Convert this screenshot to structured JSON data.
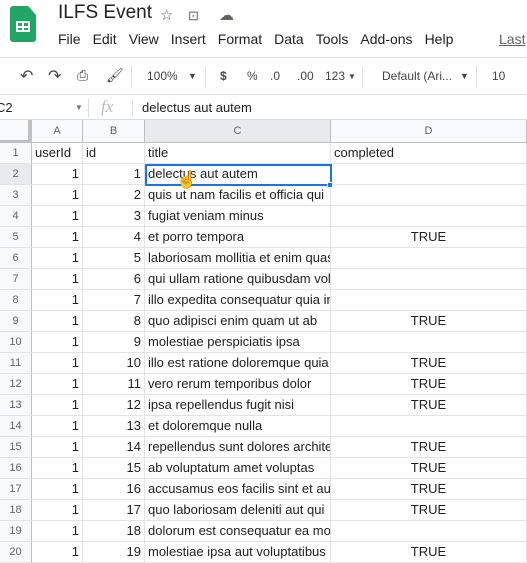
{
  "app": {
    "title": "ILFS Event",
    "last_edit": "Last",
    "icons": [
      "star-icon",
      "move-folder-icon",
      "cloud-saved-icon"
    ]
  },
  "menu": [
    "File",
    "Edit",
    "View",
    "Insert",
    "Format",
    "Data",
    "Tools",
    "Add-ons",
    "Help"
  ],
  "toolbar": {
    "zoom": "100%",
    "currency": "$",
    "percent": "%",
    "dec_decrease": ".0",
    "dec_increase": ".00",
    "format_more": "123",
    "font": "Default (Ari...",
    "font_size": "10"
  },
  "formula_bar": {
    "cell_ref": "C2",
    "fx": "fx",
    "value": "delectus aut autem"
  },
  "columns": [
    "A",
    "B",
    "C",
    "D"
  ],
  "header_row": [
    "userId",
    "id",
    "title",
    "completed"
  ],
  "rows": [
    [
      "1",
      "1",
      "delectus aut autem",
      ""
    ],
    [
      "1",
      "2",
      "quis ut nam facilis et officia qui",
      ""
    ],
    [
      "1",
      "3",
      "fugiat veniam minus",
      ""
    ],
    [
      "1",
      "4",
      "et porro tempora",
      "TRUE"
    ],
    [
      "1",
      "5",
      "laboriosam mollitia et enim quasi",
      ""
    ],
    [
      "1",
      "6",
      "qui ullam ratione quibusdam voluptatem",
      ""
    ],
    [
      "1",
      "7",
      "illo expedita consequatur quia in",
      ""
    ],
    [
      "1",
      "8",
      "quo adipisci enim quam ut ab",
      "TRUE"
    ],
    [
      "1",
      "9",
      "molestiae perspiciatis ipsa",
      ""
    ],
    [
      "1",
      "10",
      "illo est ratione doloremque quia",
      "TRUE"
    ],
    [
      "1",
      "11",
      "vero rerum temporibus dolor",
      "TRUE"
    ],
    [
      "1",
      "12",
      "ipsa repellendus fugit nisi",
      "TRUE"
    ],
    [
      "1",
      "13",
      "et doloremque nulla",
      ""
    ],
    [
      "1",
      "14",
      "repellendus sunt dolores architecto",
      "TRUE"
    ],
    [
      "1",
      "15",
      "ab voluptatum amet voluptas",
      "TRUE"
    ],
    [
      "1",
      "16",
      "accusamus eos facilis sint et aut",
      "TRUE"
    ],
    [
      "1",
      "17",
      "quo laboriosam deleniti aut qui",
      "TRUE"
    ],
    [
      "1",
      "18",
      "dolorum est consequatur ea mollitia",
      ""
    ],
    [
      "1",
      "19",
      "molestiae ipsa aut voluptatibus",
      "TRUE"
    ]
  ],
  "colors": {
    "accent": "#1a73e8",
    "logo": "#23a566"
  }
}
